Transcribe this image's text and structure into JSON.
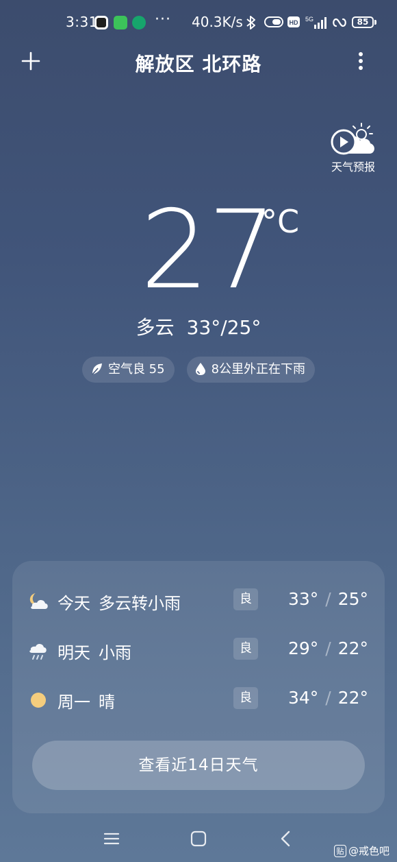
{
  "status_bar": {
    "time": "3:31",
    "more_dots": "···",
    "net_speed": "40.3K/s",
    "network": "5G",
    "battery": "85"
  },
  "header": {
    "location": "解放区 北环路"
  },
  "forecast_video": {
    "label": "天气预报"
  },
  "current": {
    "temperature": "27",
    "unit": "°C",
    "condition": "多云",
    "high_low": "33°/25°"
  },
  "chips": {
    "air_quality": "空气良 55",
    "rain_alert": "8公里外正在下雨"
  },
  "forecast": {
    "days": [
      {
        "day": "今天",
        "condition": "多云转小雨",
        "aqi": "良",
        "high": "33°",
        "low": "25°",
        "icon": "partly-cloudy-night-icon"
      },
      {
        "day": "明天",
        "condition": "小雨",
        "aqi": "良",
        "high": "29°",
        "low": "22°",
        "icon": "light-rain-icon"
      },
      {
        "day": "周一",
        "condition": "晴",
        "aqi": "良",
        "high": "34°",
        "low": "22°",
        "icon": "sunny-icon"
      }
    ],
    "separator": "/",
    "button_label": "查看近14日天气"
  },
  "watermark": {
    "badge": "贴",
    "text": "@戒色吧"
  },
  "colors": {
    "background_top": "#3c4c6d",
    "background_bottom": "#5e7898",
    "sun": "#f5cd7d",
    "text": "#ffffff"
  }
}
